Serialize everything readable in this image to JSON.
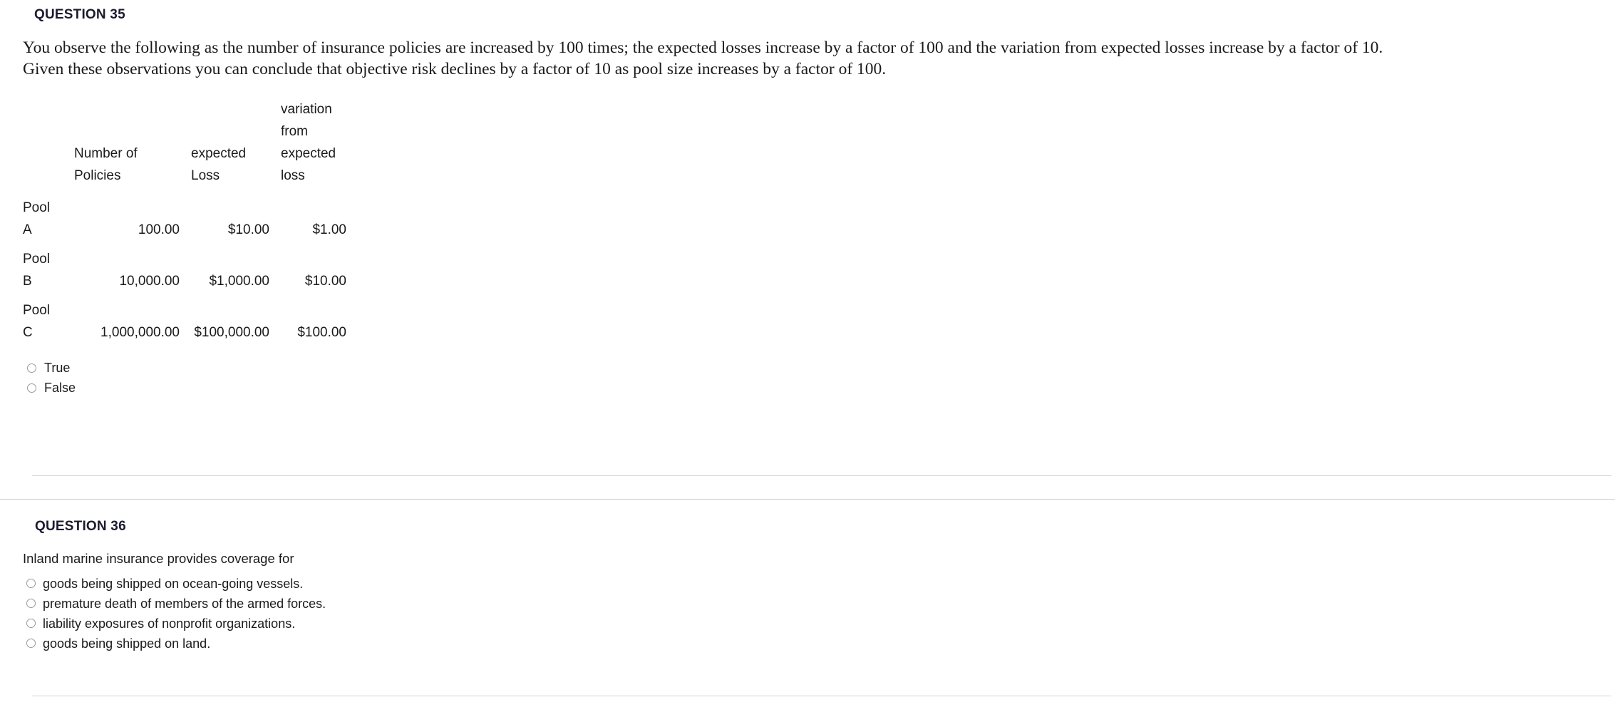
{
  "q35": {
    "title": "QUESTION 35",
    "stem_lines": [
      "You observe the following as the number of insurance policies are increased by 100 times;  the expected losses increase by a factor of 100 and the variation from expected losses increase by a factor of 10.",
      "Given these observations you can conclude that objective risk declines by a factor of 10 as pool size increases by a factor of 100."
    ],
    "table": {
      "headers": {
        "label": "",
        "policies": [
          "Number of",
          "Policies"
        ],
        "expected_loss": [
          "expected",
          "Loss"
        ],
        "variation": [
          "variation",
          "from",
          "expected",
          "loss"
        ]
      },
      "rows": [
        {
          "label_line1": "Pool",
          "label_line2": "A",
          "policies": "100.00",
          "expected_loss": "$10.00",
          "variation": "$1.00"
        },
        {
          "label_line1": "Pool",
          "label_line2": "B",
          "policies": "10,000.00",
          "expected_loss": "$1,000.00",
          "variation": "$10.00"
        },
        {
          "label_line1": "Pool",
          "label_line2": "C",
          "policies": "1,000,000.00",
          "expected_loss": "$100,000.00",
          "variation": "$100.00"
        }
      ]
    },
    "options": [
      {
        "label": "True"
      },
      {
        "label": "False"
      }
    ]
  },
  "q36": {
    "title": "QUESTION 36",
    "stem": "Inland marine insurance provides coverage for",
    "options": [
      {
        "label": "goods being shipped on ocean-going vessels."
      },
      {
        "label": "premature death of members of the armed forces."
      },
      {
        "label": "liability exposures of nonprofit organizations."
      },
      {
        "label": "goods being shipped on land."
      }
    ]
  },
  "colors": {
    "page_background": "#ffffff",
    "text": "#1a1a1a",
    "title_text": "#1b1b2f",
    "divider": "#d3d3d3",
    "radio_border": "#9a9a9a"
  }
}
